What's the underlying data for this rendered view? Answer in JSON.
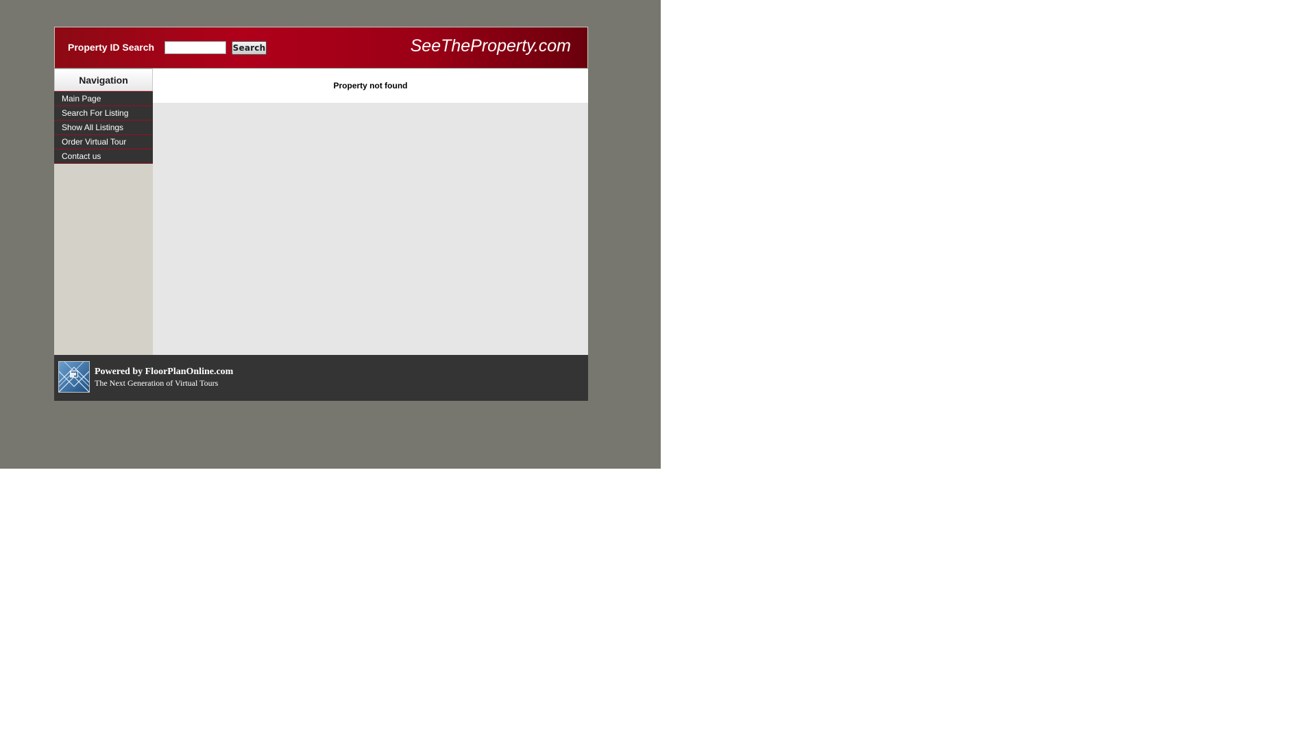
{
  "header": {
    "search_label": "Property ID Search",
    "search_value": "",
    "search_button": "Search",
    "site_title": "SeeTheProperty.com"
  },
  "navigation": {
    "heading": "Navigation",
    "items": [
      {
        "label": "Main Page"
      },
      {
        "label": "Search For Listing"
      },
      {
        "label": "Show All Listings"
      },
      {
        "label": "Order Virtual Tour"
      },
      {
        "label": "Contact us"
      }
    ]
  },
  "content": {
    "message": "Property not found"
  },
  "footer": {
    "logo_icon": "floorplan-logo-icon",
    "powered_by": "Powered by FloorPlanOnline.com",
    "tagline": "The Next Generation of Virtual Tours"
  },
  "colors": {
    "page_background": "#777770",
    "header_red": "#b0001a",
    "nav_item_bg": "#333333",
    "nav_separator": "#9a1020",
    "sidebar_bg": "#d4d1c9",
    "content_bg": "#e6e6e6",
    "footer_bg": "#343434"
  }
}
